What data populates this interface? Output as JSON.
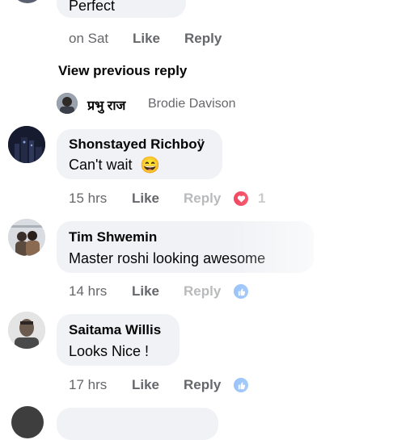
{
  "top_comment": {
    "text": "Perfect",
    "time": "on Sat",
    "like": "Like",
    "reply": "Reply"
  },
  "view_previous": "View previous reply",
  "reply_preview": {
    "name": "प्रभु राज",
    "mention": "Brodie Davison"
  },
  "comments": [
    {
      "name": "Shonstayed Richboÿ",
      "text": "Can't wait",
      "emoji": "😄",
      "time": "15 hrs",
      "like": "Like",
      "reply": "Reply",
      "reaction_count": "1",
      "reaction_icon": "heart-reaction-icon"
    },
    {
      "name": "Tim Shwemin",
      "text": "Master roshi looking awesome",
      "time": "14 hrs",
      "like": "Like",
      "reply": "Reply",
      "reaction_icon": "like-reaction-icon"
    },
    {
      "name": "Saitama Willis",
      "text": "Looks Nice !",
      "time": "17 hrs",
      "like": "Like",
      "reply": "Reply",
      "reaction_icon": "like-reaction-icon"
    }
  ],
  "colors": {
    "bubble": "#f0f2f5",
    "meta_text": "#65676b",
    "love": "#f33e58",
    "like": "#1877f2"
  }
}
